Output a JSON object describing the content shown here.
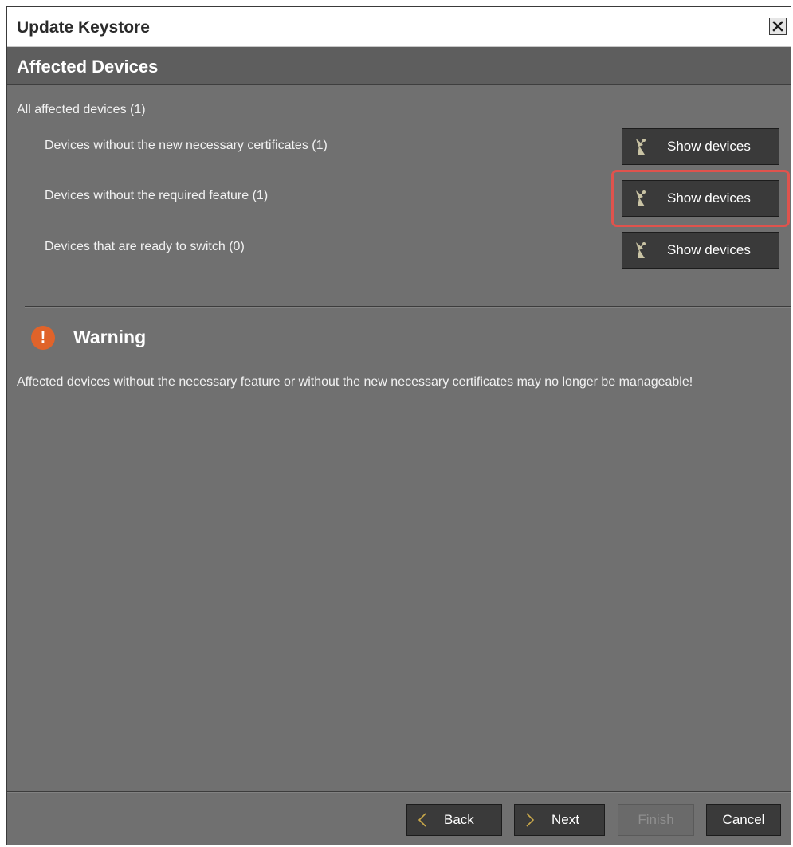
{
  "window": {
    "title": "Update Keystore",
    "close_icon": "close-icon"
  },
  "header": {
    "title": "Affected Devices"
  },
  "devices": {
    "all_label": "All affected devices (1)",
    "rows": [
      {
        "label": "Devices without the new necessary certificates (1)",
        "button_label": "Show devices",
        "highlighted": false
      },
      {
        "label": "Devices without the required feature (1)",
        "button_label": "Show devices",
        "highlighted": true
      },
      {
        "label": "Devices that are ready to switch (0)",
        "button_label": "Show devices",
        "highlighted": false
      }
    ],
    "button_icon": "device-antenna-icon"
  },
  "warning": {
    "icon": "exclamation-icon",
    "title": "Warning",
    "message": "Affected devices without the necessary feature or without the new necessary certificates may no longer be manageable!"
  },
  "footer": {
    "back": {
      "mnemonic": "B",
      "rest": "ack",
      "enabled": true
    },
    "next": {
      "mnemonic": "N",
      "rest": "ext",
      "enabled": true
    },
    "finish": {
      "mnemonic": "F",
      "rest": "inish",
      "enabled": false
    },
    "cancel": {
      "mnemonic": "C",
      "rest": "ancel",
      "enabled": true
    }
  },
  "colors": {
    "background": "#707070",
    "button": "#3a3a3a",
    "highlight": "#e0534d",
    "warning": "#e0632a"
  }
}
